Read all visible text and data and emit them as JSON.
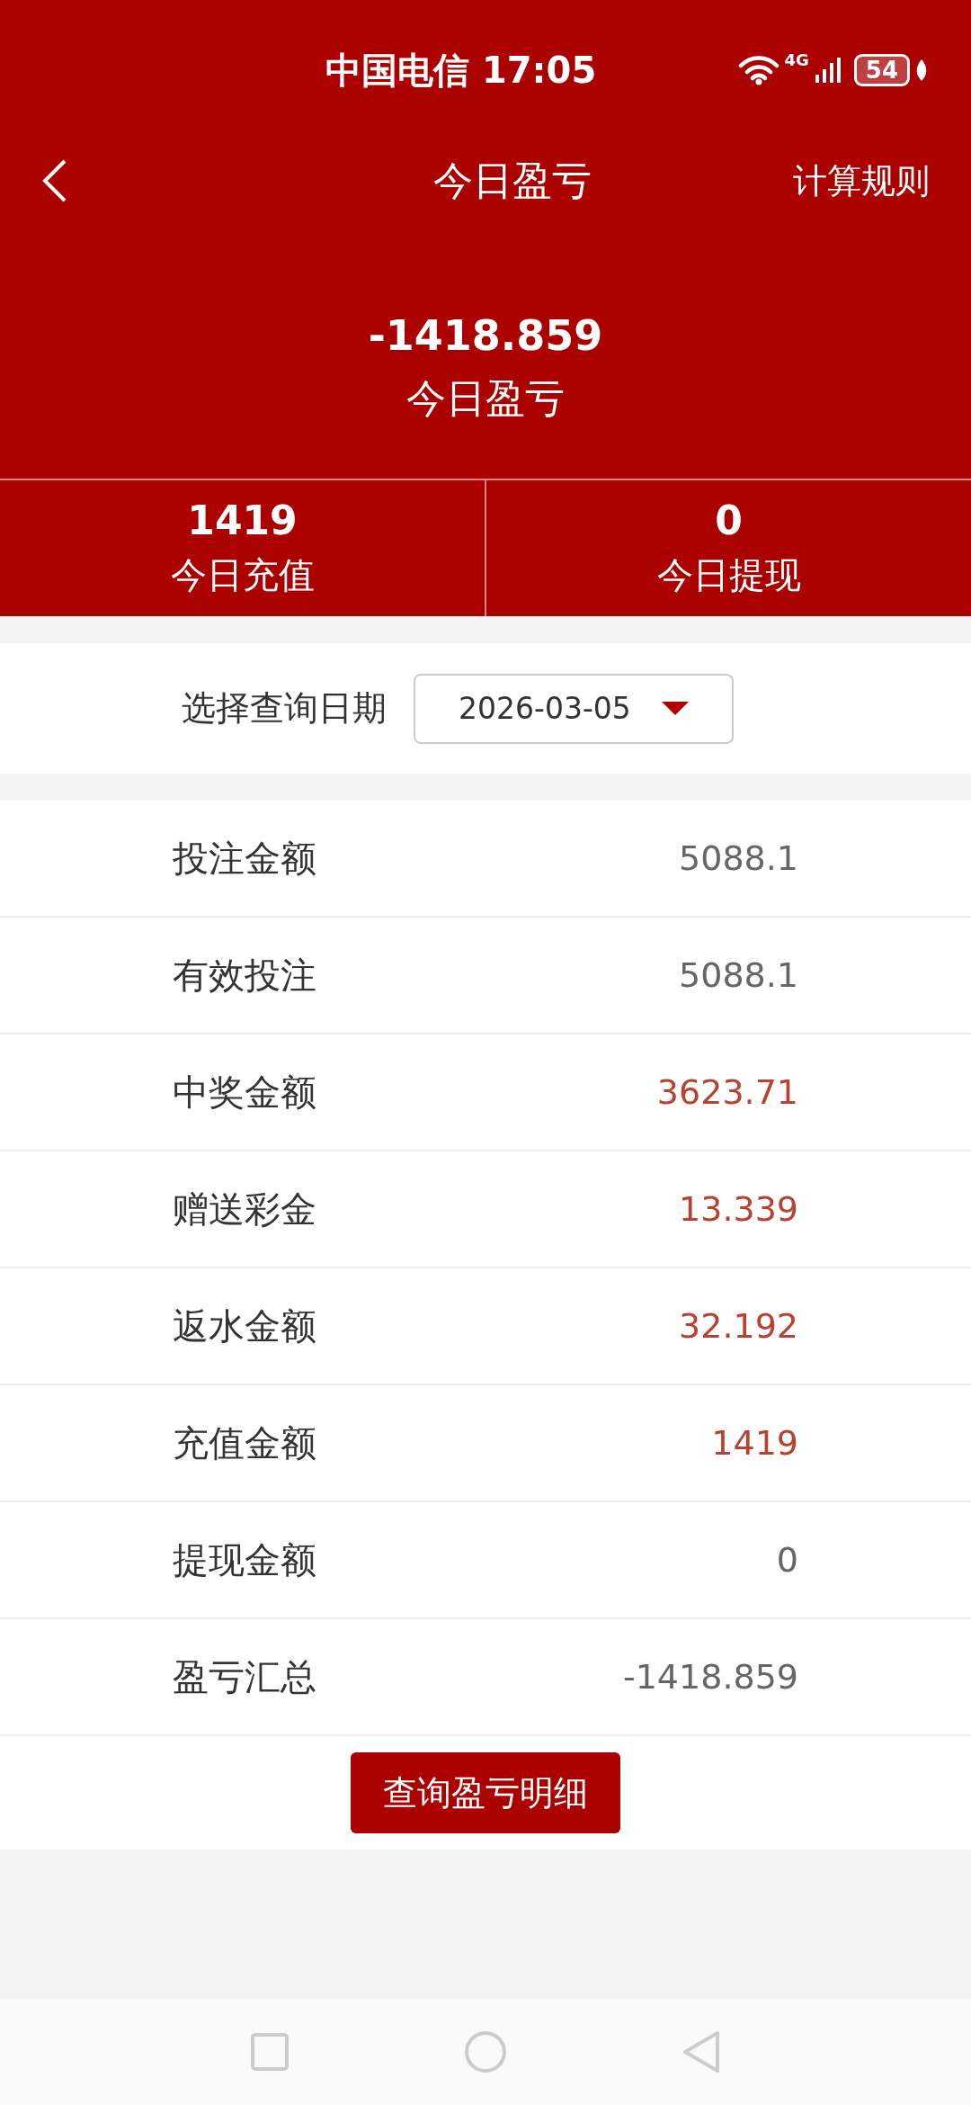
{
  "status_bar": {
    "carrier": "中国电信",
    "time": "17:05",
    "network": "4G",
    "battery": "54"
  },
  "header": {
    "title": "今日盈亏",
    "action": "计算规则"
  },
  "summary": {
    "value": "-1418.859",
    "label": "今日盈亏"
  },
  "stats": [
    {
      "value": "1419",
      "label": "今日充值"
    },
    {
      "value": "0",
      "label": "今日提现"
    }
  ],
  "date_filter": {
    "label": "选择查询日期",
    "value": "2026-03-05"
  },
  "rows": [
    {
      "label": "投注金额",
      "value": "5088.1",
      "color": "#666666"
    },
    {
      "label": "有效投注",
      "value": "5088.1",
      "color": "#666666"
    },
    {
      "label": "中奖金额",
      "value": "3623.71",
      "color": "#b8412f"
    },
    {
      "label": "赠送彩金",
      "value": "13.339",
      "color": "#b8412f"
    },
    {
      "label": "返水金额",
      "value": "32.192",
      "color": "#b8412f"
    },
    {
      "label": "充值金额",
      "value": "1419",
      "color": "#b8412f"
    },
    {
      "label": "提现金额",
      "value": "0",
      "color": "#666666"
    },
    {
      "label": "盈亏汇总",
      "value": "-1418.859",
      "color": "#666666"
    }
  ],
  "detail_button": "查询盈亏明细"
}
